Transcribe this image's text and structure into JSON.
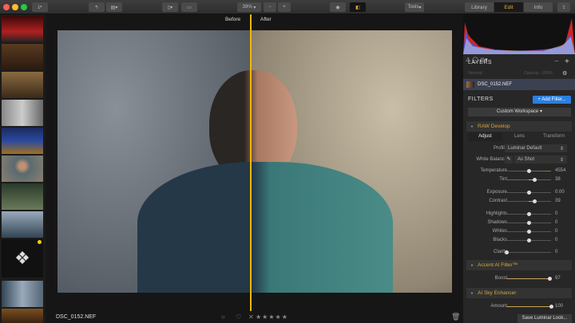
{
  "toolbar": {
    "zoom": "39%",
    "minus": "−",
    "plus": "+",
    "tools": "Tools",
    "tabs": [
      "Library",
      "Edit",
      "Info"
    ],
    "active_tab": "Edit"
  },
  "compare": {
    "before": "Before",
    "after": "After"
  },
  "footer": {
    "filename": "DSC_0152.NEF",
    "stars": "★★★★★",
    "reject": "✕",
    "heart": "♡",
    "circle": "○"
  },
  "layers": {
    "title": "LAYERS",
    "minus": "−",
    "plus": "+",
    "blend": "Normal",
    "opacity": "Opacity: 100%",
    "layer_name": "DSC_0152.NEF"
  },
  "filters": {
    "title": "FILTERS",
    "add": "+ Add Filter...",
    "workspace": "Custom Workspace"
  },
  "raw": {
    "title": "RAW Develop",
    "tabs": [
      "Adjust",
      "Lens",
      "Transform"
    ],
    "profile_label": "Profile",
    "profile": "Luminar Default",
    "wb_label": "White Balance",
    "wb": "As Shot",
    "sliders": [
      {
        "label": "Temperature",
        "value": "4554",
        "pos": 0.5
      },
      {
        "label": "Tint",
        "value": "38",
        "pos": 0.62
      },
      {
        "label": "Exposure",
        "value": "0.00",
        "pos": 0.5
      },
      {
        "label": "Contrast",
        "value": "39",
        "pos": 0.62
      },
      {
        "label": "Highlights",
        "value": "0",
        "pos": 0.5
      },
      {
        "label": "Shadows",
        "value": "0",
        "pos": 0.5
      },
      {
        "label": "Whites",
        "value": "0",
        "pos": 0.5
      },
      {
        "label": "Blacks",
        "value": "0",
        "pos": 0.5
      },
      {
        "label": "Clarity",
        "value": "0",
        "pos": 0.0
      }
    ]
  },
  "accent": {
    "title": "Accent AI Filter™",
    "label": "Boost",
    "value": "97",
    "pos": 0.97
  },
  "sky": {
    "title": "AI Sky Enhancer",
    "label": "Amount",
    "value": "100",
    "pos": 1.0
  },
  "save": "Save Luminar Look..."
}
